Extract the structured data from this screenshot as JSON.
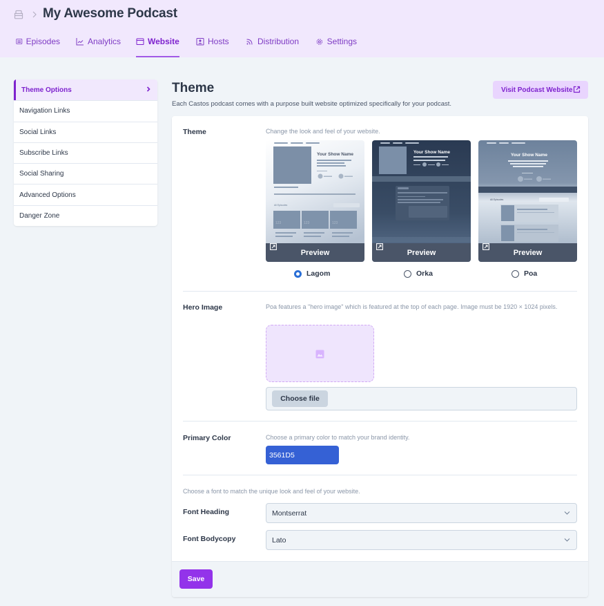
{
  "header": {
    "title": "My Awesome Podcast",
    "breadcrumb_icons": [
      "home-icon",
      "chevron-right-icon"
    ],
    "tabs": [
      {
        "label": "Episodes",
        "icon": "list-icon",
        "active": false
      },
      {
        "label": "Analytics",
        "icon": "chart-line-icon",
        "active": false
      },
      {
        "label": "Website",
        "icon": "browser-window-icon",
        "active": true
      },
      {
        "label": "Hosts",
        "icon": "user-card-icon",
        "active": false
      },
      {
        "label": "Distribution",
        "icon": "rss-icon",
        "active": false
      },
      {
        "label": "Settings",
        "icon": "gear-icon",
        "active": false
      }
    ]
  },
  "sidebar": {
    "items": [
      {
        "label": "Theme Options",
        "active": true
      },
      {
        "label": "Navigation Links",
        "active": false
      },
      {
        "label": "Social Links",
        "active": false
      },
      {
        "label": "Subscribe Links",
        "active": false
      },
      {
        "label": "Social Sharing",
        "active": false
      },
      {
        "label": "Advanced Options",
        "active": false
      },
      {
        "label": "Danger Zone",
        "active": false
      }
    ]
  },
  "main": {
    "title": "Theme",
    "subtitle": "Each Castos podcast comes with a purpose built website optimized specifically for your podcast.",
    "visit_button": "Visit Podcast Website",
    "theme": {
      "label": "Theme",
      "help": "Change the look and feel of your website.",
      "preview_label": "Preview",
      "thumb_show_name": "Your Show Name",
      "thumb_all_episodes": "All Episodes",
      "thumb_episode_number": "123",
      "options": [
        {
          "name": "Lagom",
          "selected": true
        },
        {
          "name": "Orka",
          "selected": false
        },
        {
          "name": "Poa",
          "selected": false
        }
      ]
    },
    "hero_image": {
      "label": "Hero Image",
      "help": "Poa features a \"hero image\" which is featured at the top of each page. Image must be 1920 × 1024 pixels.",
      "choose_file": "Choose file"
    },
    "primary_color": {
      "label": "Primary Color",
      "help": "Choose a primary color to match your brand identity.",
      "value": "3561D5",
      "swatch": "#3561D5"
    },
    "fonts": {
      "help": "Choose a font to match the unique look and feel of your website.",
      "heading_label": "Font Heading",
      "heading_value": "Montserrat",
      "body_label": "Font Bodycopy",
      "body_value": "Lato"
    },
    "save_label": "Save"
  },
  "colors": {
    "accent": "#7E22CE",
    "header_bg": "#F1E8FD",
    "save_button": "#9333EA",
    "radio_checked": "#2A6FD6"
  }
}
